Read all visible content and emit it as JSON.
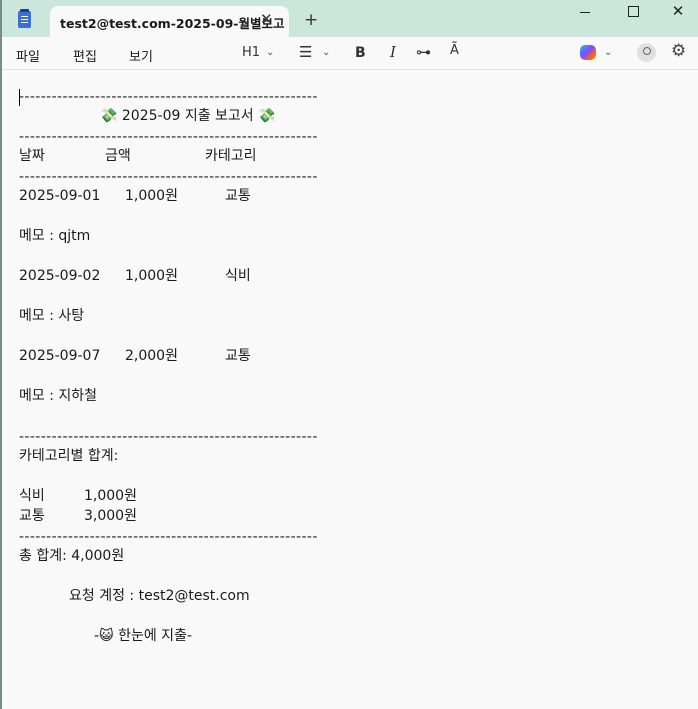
{
  "window": {
    "tab_title": "test2@test.com-2025-09-월별보고",
    "tab_close": "✕",
    "new_tab": "+",
    "controls": {
      "minimize": "minimize-icon",
      "maximize": "maximize-icon",
      "close": "✕"
    }
  },
  "toolbar": {
    "menu": [
      "파일",
      "편집",
      "보기"
    ],
    "heading": "H1",
    "list_icon": "☰",
    "bold": "B",
    "italic": "I",
    "link_icon": "⊶",
    "spell_icon": "A͂",
    "gear_icon": "⚙",
    "chevron": "⌄"
  },
  "document": {
    "divider": "-------------------------------------------------------",
    "title": "💸 2025-09 지출 보고서 💸",
    "headers": {
      "date": "날짜",
      "amount": "금액",
      "category": "카테고리"
    },
    "entries": [
      {
        "date": "2025-09-01",
        "amount": "1,000원",
        "category": "교통",
        "memo": "메모 : qjtm"
      },
      {
        "date": "2025-09-02",
        "amount": "1,000원",
        "category": "식비",
        "memo": "메모 : 사탕"
      },
      {
        "date": "2025-09-07",
        "amount": "2,000원",
        "category": "교통",
        "memo": "메모 : 지하철"
      }
    ],
    "category_totals_label": "카테고리별 합계:",
    "category_totals": [
      {
        "name": "식비",
        "amount": "1,000원"
      },
      {
        "name": "교통",
        "amount": "3,000원"
      }
    ],
    "grand_total": "총 합계: 4,000원",
    "account": "요청 계정 : test2@test.com",
    "footer": "-😺 한눈에 지출-"
  }
}
